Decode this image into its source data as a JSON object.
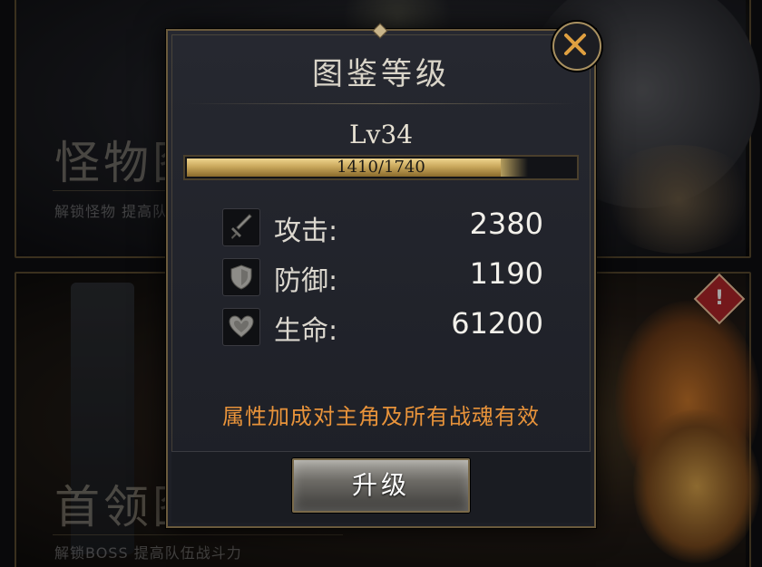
{
  "background": {
    "card1": {
      "title": "怪物图鉴",
      "subtitle": "解锁怪物 提高队伍战斗力"
    },
    "card2": {
      "title": "首领图鉴",
      "subtitle": "解锁BOSS 提高队伍战斗力"
    },
    "alert_symbol": "!"
  },
  "dialog": {
    "title": "图鉴等级",
    "level": "Lv34",
    "xp": {
      "current": 1410,
      "max": 1740,
      "text": "1410/1740",
      "fraction": 0.81
    },
    "stats": [
      {
        "label": "攻击:",
        "value": "2380",
        "icon": "sword-icon"
      },
      {
        "label": "防御:",
        "value": "1190",
        "icon": "shield-icon"
      },
      {
        "label": "生命:",
        "value": "61200",
        "icon": "heart-icon"
      }
    ],
    "note": "属性加成对主角及所有战魂有效",
    "upgrade_label": "升级",
    "close_icon": "close-icon"
  },
  "colors": {
    "accent_gold": "#c9a85c",
    "note_orange": "#e8933a",
    "alert_red": "#b3262a"
  }
}
